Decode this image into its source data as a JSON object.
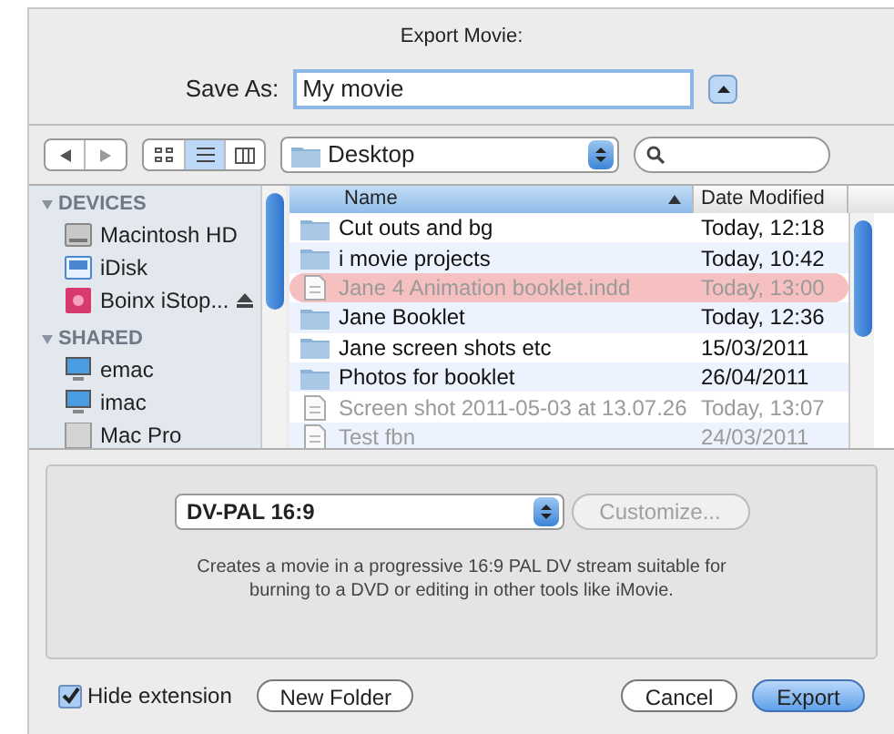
{
  "dialog": {
    "title": "Export Movie:"
  },
  "save_as": {
    "label": "Save As:",
    "value": "My movie",
    "expanded": true
  },
  "toolbar": {
    "view_modes": [
      {
        "kind": "icons",
        "selected": false
      },
      {
        "kind": "list",
        "selected": true
      },
      {
        "kind": "columns",
        "selected": false
      }
    ],
    "location": "Desktop"
  },
  "sidebar": [
    {
      "heading": "DEVICES",
      "expanded": true,
      "items": [
        {
          "label": "Macintosh HD",
          "kind": "disk",
          "ejectable": false
        },
        {
          "label": "iDisk",
          "kind": "idisk",
          "ejectable": false
        },
        {
          "label": "Boinx iStop...",
          "kind": "app",
          "ejectable": true
        }
      ]
    },
    {
      "heading": "SHARED",
      "expanded": true,
      "items": [
        {
          "label": "emac",
          "kind": "computer",
          "ejectable": false
        },
        {
          "label": "imac",
          "kind": "computer",
          "ejectable": false
        },
        {
          "label": "Mac Pro",
          "kind": "server",
          "ejectable": false
        }
      ]
    }
  ],
  "table": {
    "columns": [
      {
        "label": "Name",
        "sorted": true
      },
      {
        "label": "Date Modified",
        "sorted": false
      }
    ],
    "rows": [
      {
        "name": "Cut outs and bg",
        "date": "Today, 12:18",
        "kind": "folder",
        "disabled": false
      },
      {
        "name": "i movie projects",
        "date": "Today, 10:42",
        "kind": "folder",
        "disabled": false
      },
      {
        "name": "Jane 4 Animation booklet.indd",
        "date": "Today, 13:00",
        "kind": "document",
        "disabled": true,
        "color": "#f6c0c0"
      },
      {
        "name": "Jane Booklet",
        "date": "Today, 12:36",
        "kind": "folder",
        "disabled": false
      },
      {
        "name": "Jane screen shots etc",
        "date": "15/03/2011",
        "kind": "folder",
        "disabled": false
      },
      {
        "name": "Photos for booklet",
        "date": "26/04/2011",
        "kind": "folder",
        "disabled": false
      },
      {
        "name": "Screen shot 2011-05-03 at 13.07.26",
        "date": "Today, 13:07",
        "kind": "document",
        "disabled": true
      },
      {
        "name": "Test fbn",
        "date": "24/03/2011",
        "kind": "document",
        "disabled": true
      }
    ]
  },
  "format": {
    "value": "DV-PAL 16:9",
    "customize": {
      "label": "Customize...",
      "disabled": true
    },
    "description": "Creates a movie in a progressive 16:9 PAL DV stream suitable for burning to a DVD or editing in other tools like iMovie."
  },
  "hide_extension": {
    "label": "Hide extension",
    "checked": true
  },
  "buttons": [
    {
      "label": "New Folder",
      "kind": "secondary"
    },
    {
      "label": "Cancel",
      "kind": "secondary"
    },
    {
      "label": "Export",
      "kind": "default"
    }
  ]
}
